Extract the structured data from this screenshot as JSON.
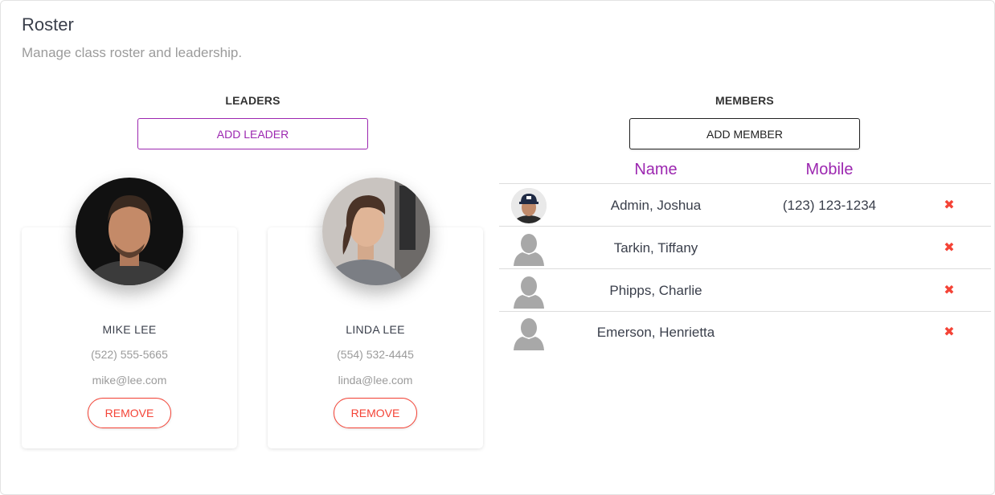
{
  "page": {
    "title": "Roster",
    "subtitle": "Manage class roster and leadership."
  },
  "leaders": {
    "heading": "LEADERS",
    "add_label": "ADD LEADER",
    "items": [
      {
        "name": "MIKE LEE",
        "phone": "(522) 555-5665",
        "email": "mike@lee.com",
        "remove_label": "REMOVE"
      },
      {
        "name": "LINDA LEE",
        "phone": "(554) 532-4445",
        "email": "linda@lee.com",
        "remove_label": "REMOVE"
      }
    ]
  },
  "members": {
    "heading": "MEMBERS",
    "add_label": "ADD MEMBER",
    "columns": {
      "name": "Name",
      "mobile": "Mobile"
    },
    "rows": [
      {
        "name": "Admin, Joshua",
        "mobile": "(123) 123-1234",
        "avatar": "photo",
        "delete_glyph": "✖"
      },
      {
        "name": "Tarkin, Tiffany",
        "mobile": "",
        "avatar": "placeholder",
        "delete_glyph": "✖"
      },
      {
        "name": "Phipps, Charlie",
        "mobile": "",
        "avatar": "placeholder",
        "delete_glyph": "✖"
      },
      {
        "name": "Emerson, Henrietta",
        "mobile": "",
        "avatar": "placeholder",
        "delete_glyph": "✖"
      }
    ]
  },
  "colors": {
    "accent": "#9c27b0",
    "danger": "#f44336",
    "text": "#3a3f4b",
    "muted": "#9b9b9b"
  }
}
